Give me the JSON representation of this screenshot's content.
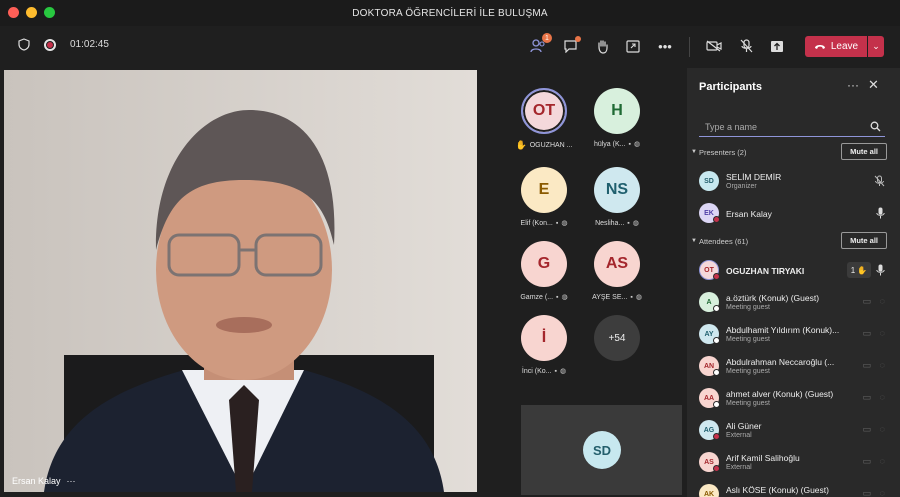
{
  "window": {
    "title": "DOKTORA ÖĞRENCİLERİ İLE BULUŞMA"
  },
  "toolbar": {
    "timer": "01:02:45",
    "participants_badge": "1",
    "leave_label": "Leave"
  },
  "main_video": {
    "speaker_name": "Ersan Kalay",
    "more": "···"
  },
  "gallery": {
    "tiles": [
      {
        "initials": "OT",
        "label": "OGUZHAN ...",
        "bg": "#f4d8db",
        "fg": "#a4262c"
      },
      {
        "initials": "H",
        "label": "hülya (K...",
        "bg": "#d8f0dd",
        "fg": "#1f6a34"
      },
      {
        "initials": "E",
        "label": "Elif (Kon...",
        "bg": "#fbe9c4",
        "fg": "#8a5a00"
      },
      {
        "initials": "NS",
        "label": "Nesliha...",
        "bg": "#cfe8ef",
        "fg": "#1f5f6e"
      },
      {
        "initials": "G",
        "label": "Gamze (...",
        "bg": "#f8d5d0",
        "fg": "#a4262c"
      },
      {
        "initials": "AS",
        "label": "AYŞE SE...",
        "bg": "#f8d5d0",
        "fg": "#a4262c"
      },
      {
        "initials": "İ",
        "label": "İnci (Ko...",
        "bg": "#f8d5d0",
        "fg": "#a4262c"
      }
    ],
    "overflow": "+54",
    "self_initials": "SD"
  },
  "panel": {
    "title": "Participants",
    "search_placeholder": "Type a name",
    "presenters_label": "Presenters (2)",
    "attendees_label": "Attendees (61)",
    "mute_all": "Mute all",
    "hand_count": "1",
    "presenters": [
      {
        "initials": "SD",
        "name": "SELİM DEMİR",
        "sub": "Organizer",
        "bg": "#c7e8ef",
        "fg": "#235f6c"
      },
      {
        "initials": "EK",
        "name": "Ersan Kalay",
        "sub": "",
        "bg": "#dcd6f5",
        "fg": "#4f3fa6"
      }
    ],
    "attendees": [
      {
        "initials": "OT",
        "name": "OGUZHAN TIRYAKI",
        "sub": "",
        "bg": "#f4d8db",
        "fg": "#a4262c"
      },
      {
        "initials": "A",
        "name": "a.öztürk (Konuk) (Guest)",
        "sub": "Meeting guest",
        "bg": "#d8f0dd",
        "fg": "#1f6a34"
      },
      {
        "initials": "AY",
        "name": "Abdulhamit Yıldırım (Konuk)...",
        "sub": "Meeting guest",
        "bg": "#cfe8ef",
        "fg": "#1f5f6e"
      },
      {
        "initials": "AN",
        "name": "Abdulrahman Neccaroğlu (...",
        "sub": "Meeting guest",
        "bg": "#f8d5d0",
        "fg": "#a4262c"
      },
      {
        "initials": "AA",
        "name": "ahmet alver (Konuk) (Guest)",
        "sub": "Meeting guest",
        "bg": "#f8d5d0",
        "fg": "#a4262c"
      },
      {
        "initials": "AG",
        "name": "Ali Güner",
        "sub": "External",
        "bg": "#cfe8ef",
        "fg": "#1f5f6e"
      },
      {
        "initials": "AS",
        "name": "Arif Kamil Salihoğlu",
        "sub": "External",
        "bg": "#f8d5d0",
        "fg": "#a4262c"
      },
      {
        "initials": "AK",
        "name": "Aslı KÖSE (Konuk) (Guest)",
        "sub": "",
        "bg": "#fbe9c4",
        "fg": "#8a5a00"
      }
    ]
  }
}
